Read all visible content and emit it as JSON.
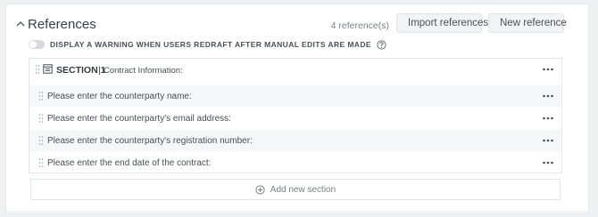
{
  "header": {
    "title": "References",
    "reference_count": "4 reference(s)",
    "import_label": "Import references",
    "new_label": "New reference"
  },
  "warning": {
    "label": "DISPLAY A WARNING WHEN USERS REDRAFT AFTER MANUAL EDITS ARE MADE",
    "enabled": false
  },
  "section": {
    "title": "SECTION 1",
    "separator": "|",
    "name": "Contract Information:",
    "rows": [
      {
        "label": "Please enter the counterparty name:"
      },
      {
        "label": "Please enter the counterparty's email address:"
      },
      {
        "label": "Please enter the counterparty's registration number:"
      },
      {
        "label": "Please enter the end date of the contract:"
      }
    ]
  },
  "add_section_label": "Add new section",
  "icons": {
    "collapse": "chevron-up-icon",
    "import": "import-document-icon",
    "new": "plus-circle-icon",
    "help": "question-circle-icon",
    "drag": "drag-handle-icon",
    "section": "document-icon",
    "more": "more-horizontal-icon"
  }
}
